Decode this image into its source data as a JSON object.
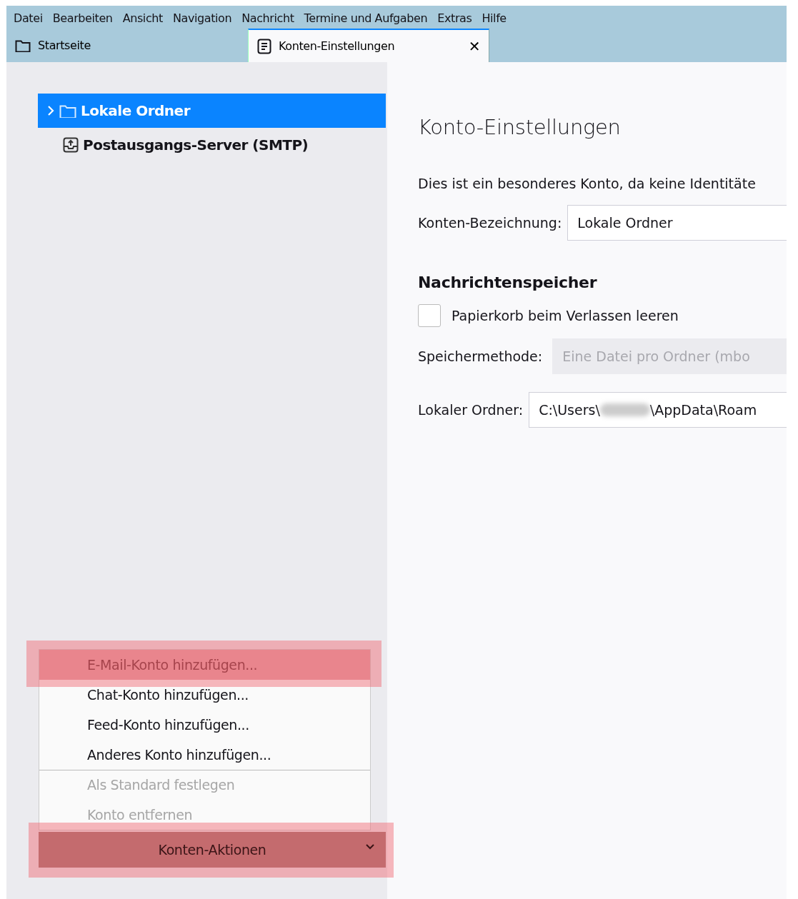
{
  "menu_bar": [
    "Datei",
    "Bearbeiten",
    "Ansicht",
    "Navigation",
    "Nachricht",
    "Termine und Aufgaben",
    "Extras",
    "Hilfe"
  ],
  "tabs": [
    {
      "label": "Startseite",
      "kind": "folder",
      "selected": false,
      "closable": false
    },
    {
      "label": "Konten-Einstellungen",
      "kind": "document",
      "selected": true,
      "closable": true
    }
  ],
  "close_glyph": "✕",
  "sidebar": {
    "items": [
      {
        "label": "Lokale Ordner",
        "kind": "folder",
        "selected": true
      },
      {
        "label": "Postausgangs-Server (SMTP)",
        "kind": "outbox",
        "selected": false
      }
    ]
  },
  "account_actions_menu": {
    "items": [
      {
        "label": "E-Mail-Konto hinzufügen...",
        "disabled": false,
        "highlighted": true,
        "separator_before": false
      },
      {
        "label": "Chat-Konto hinzufügen...",
        "disabled": false,
        "highlighted": false,
        "separator_before": false
      },
      {
        "label": "Feed-Konto hinzufügen...",
        "disabled": false,
        "highlighted": false,
        "separator_before": false
      },
      {
        "label": "Anderes Konto hinzufügen...",
        "disabled": false,
        "highlighted": false,
        "separator_before": false
      },
      {
        "label": "Als Standard festlegen",
        "disabled": true,
        "highlighted": false,
        "separator_before": true
      },
      {
        "label": "Konto entfernen",
        "disabled": true,
        "highlighted": false,
        "separator_before": false
      }
    ]
  },
  "account_actions_button": {
    "label": "Konten-Aktionen",
    "highlighted": true
  },
  "settings": {
    "title": "Konto-Einstellungen",
    "description": "Dies ist ein besonderes Konto, da keine Identitäte",
    "account_name": {
      "label": "Konten-Bezeichnung:",
      "value": "Lokale Ordner"
    },
    "section_title": "Nachrichtenspeicher",
    "empty_trash": {
      "label": "Papierkorb beim Verlassen leeren",
      "checked": false
    },
    "storage_method": {
      "label": "Speichermethode:",
      "value": "Eine Datei pro Ordner (mbo",
      "disabled": true
    },
    "local_folder": {
      "label": "Lokaler Ordner:",
      "value_before": "C:\\Users\\",
      "value_after": "\\AppData\\Roam",
      "redacted": true
    }
  }
}
